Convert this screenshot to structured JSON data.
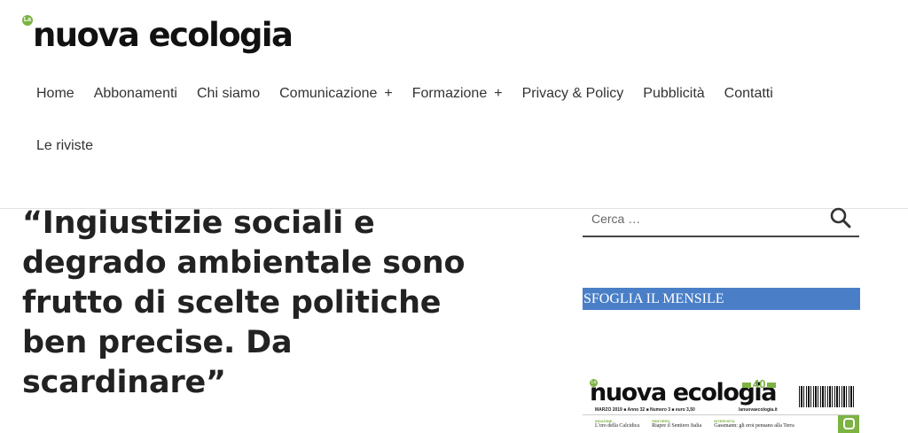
{
  "logo": {
    "badge": "La",
    "text": "nuova ecologia"
  },
  "nav": {
    "row1": [
      {
        "label": "Home",
        "plus": ""
      },
      {
        "label": "Abbonamenti",
        "plus": ""
      },
      {
        "label": "Chi siamo",
        "plus": ""
      },
      {
        "label": "Comunicazione",
        "plus": "+"
      },
      {
        "label": "Formazione",
        "plus": "+"
      },
      {
        "label": "Privacy & Policy",
        "plus": ""
      },
      {
        "label": "Pubblicità",
        "plus": ""
      },
      {
        "label": "Contatti",
        "plus": ""
      }
    ],
    "row2": [
      {
        "label": "Le riviste",
        "plus": ""
      }
    ]
  },
  "article": {
    "title_lines": [
      "“Ingiustizie sociali e",
      "degrado ambientale sono",
      "frutto di scelte politiche",
      "ben precise. Da",
      "scardinare”"
    ]
  },
  "sidebar": {
    "search_placeholder": "Cerca …",
    "sfoglia_label": "SFOGLIA IL MENSILE",
    "cover": {
      "badge": "La",
      "logo_text": "nuova ecologia",
      "anniversary": "40",
      "issue_line": "MARZO 2019 ■ Anno 32 ■ Numero 3 ■ euro 3,50",
      "url": "lanuovaecologia.it",
      "strip": [
        {
          "tag": "INDAGINE",
          "text": "L'oro della Calcidica"
        },
        {
          "tag": "SENTIERO",
          "text": "Riapre il Sentiero Italia"
        },
        {
          "tag": "INTERVISTA",
          "text": "Gassmann: gli eroi pensano alla Terra"
        }
      ]
    }
  },
  "colors": {
    "accent_green": "#7cb342",
    "sfoglia_blue": "#4a7fc8"
  }
}
